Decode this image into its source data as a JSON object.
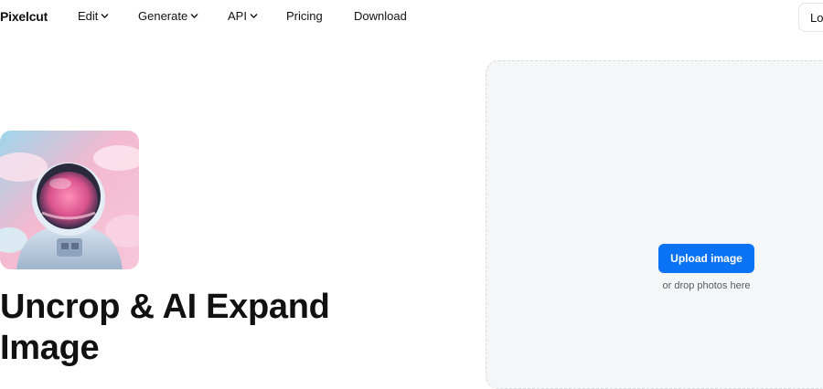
{
  "header": {
    "logo": "Pixelcut",
    "nav": [
      {
        "label": "Edit",
        "has_dropdown": true
      },
      {
        "label": "Generate",
        "has_dropdown": true
      },
      {
        "label": "API",
        "has_dropdown": true
      },
      {
        "label": "Pricing",
        "has_dropdown": false
      },
      {
        "label": "Download",
        "has_dropdown": false
      }
    ],
    "login_label": "Lo"
  },
  "hero": {
    "title": "Uncrop & AI Expand Image",
    "image_alt": "astronaut-in-clouds-image"
  },
  "upload": {
    "button_label": "Upload image",
    "hint": "or drop photos here"
  },
  "colors": {
    "accent": "#0a73f5",
    "panel_bg": "#f5f6f8",
    "text": "#111111"
  },
  "icons": {
    "dropdown": "chevron-down-icon"
  }
}
